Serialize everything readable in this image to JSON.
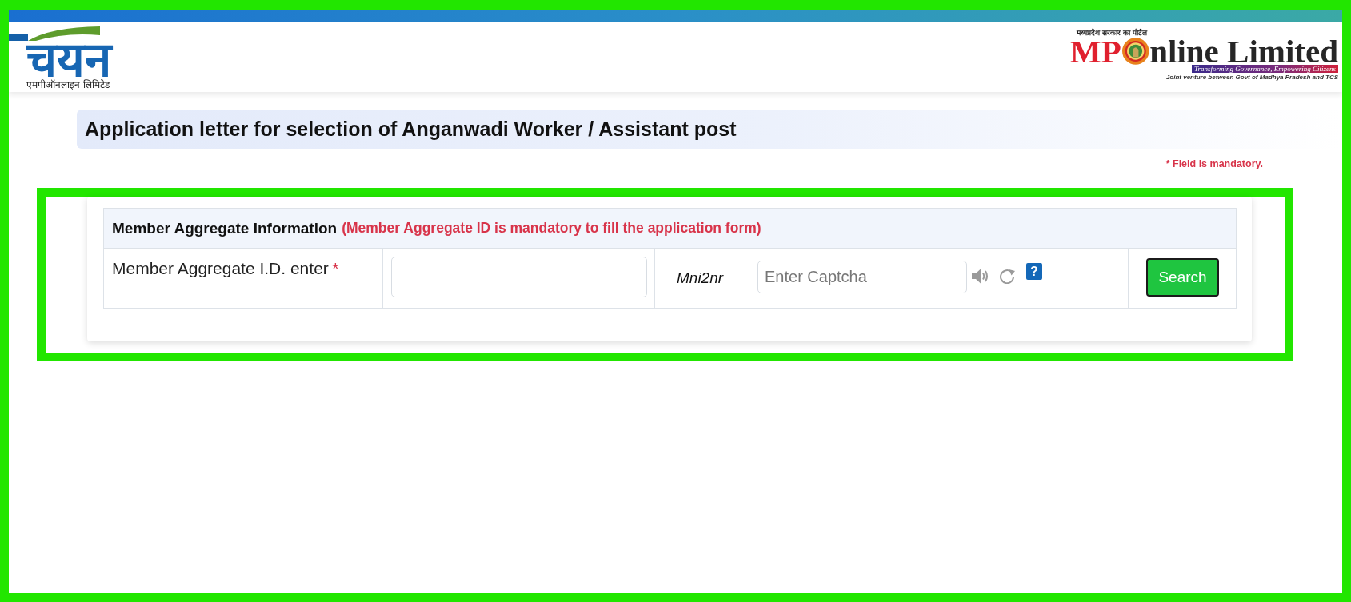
{
  "header": {
    "logo": {
      "text": "चयन",
      "subtitle": "एमपीऑनलाइन लिमिटेड"
    },
    "partner_logo": {
      "caption": "मध्यप्रदेश सरकार का पोर्टल",
      "name_parts": [
        "MP",
        "nline Limited"
      ],
      "tagline": "Transforming Governance, Empowering Citizens",
      "note": "Joint venture between Govt of Madhya Pradesh and TCS"
    }
  },
  "page_title": "Application letter for selection of Anganwadi Worker / Assistant post",
  "mandatory_note": "* Field is mandatory.",
  "form": {
    "title": "Member Aggregate Information",
    "title_note": "(Member Aggregate ID is mandatory to fill the application form)",
    "member_id": {
      "label": "Member Aggregate I.D. enter",
      "required_mark": "*"
    },
    "captcha": {
      "code": "Mni2nr",
      "placeholder": "Enter Captcha",
      "help": "?"
    },
    "button": "Search"
  }
}
